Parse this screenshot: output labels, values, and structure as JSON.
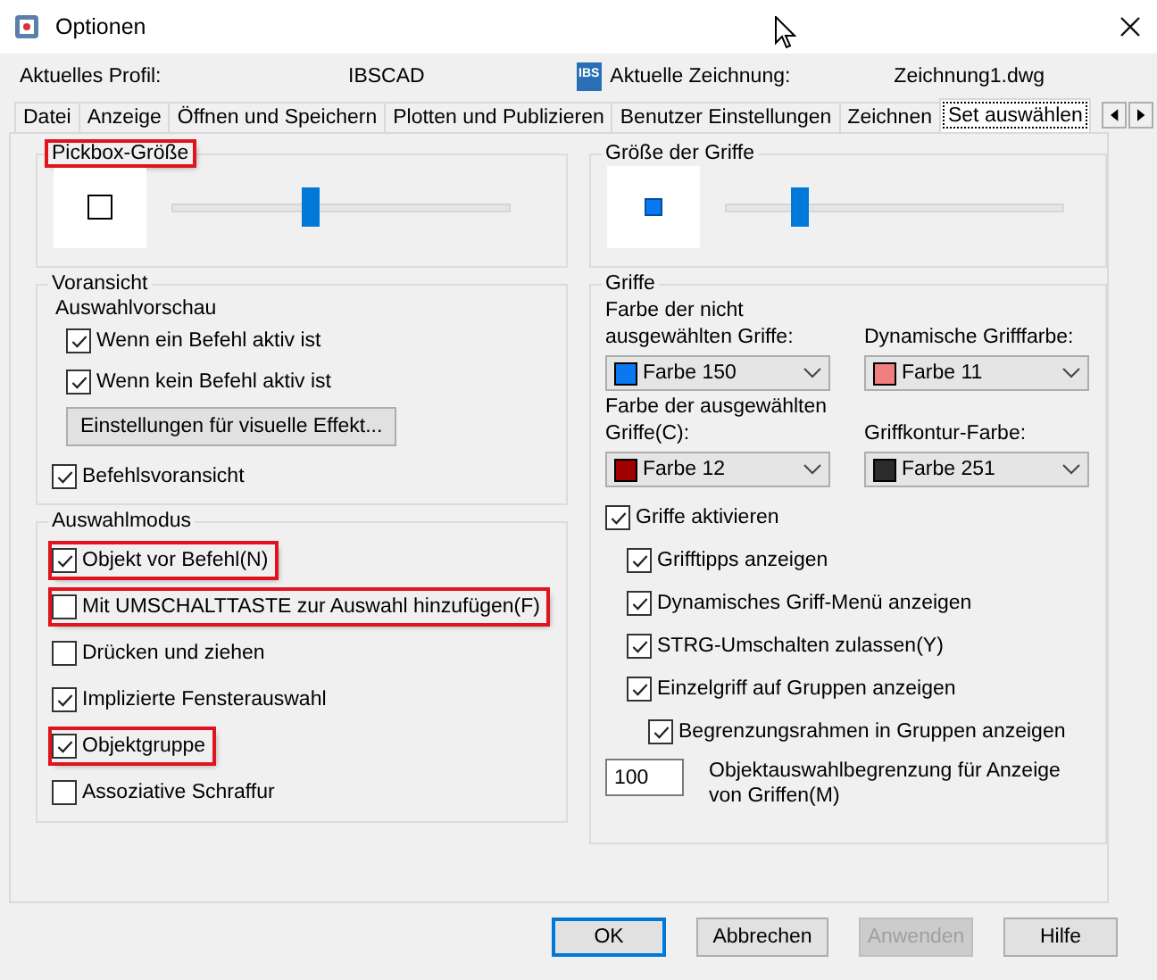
{
  "window": {
    "title": "Optionen"
  },
  "profile": {
    "label": "Aktuelles Profil:",
    "value": "IBSCAD"
  },
  "drawing": {
    "logo": "IBS",
    "label": "Aktuelle Zeichnung:",
    "value": "Zeichnung1.dwg"
  },
  "tabs": [
    {
      "label": "Datei",
      "selected": false
    },
    {
      "label": "Anzeige",
      "selected": false
    },
    {
      "label": "Öffnen und Speichern",
      "selected": false
    },
    {
      "label": "Plotten und Publizieren",
      "selected": false
    },
    {
      "label": "Benutzer Einstellungen",
      "selected": false
    },
    {
      "label": "Zeichnen",
      "selected": false
    },
    {
      "label": "Set auswählen",
      "selected": true
    }
  ],
  "pickbox": {
    "title": "Pickbox-Größe",
    "highlighted": true,
    "level": 0.41
  },
  "grip_size": {
    "title": "Größe der Griffe",
    "level": 0.22
  },
  "preview": {
    "title": "Voransicht",
    "subtitle": "Auswahlvorschau",
    "options": [
      {
        "label": "Wenn ein Befehl aktiv ist",
        "checked": true
      },
      {
        "label": "Wenn kein Befehl aktiv ist",
        "checked": true
      }
    ],
    "button": "Einstellungen für visuelle Effekt...",
    "command_preview": {
      "label": "Befehlsvoransicht",
      "checked": true
    }
  },
  "selection_mode": {
    "title": "Auswahlmodus",
    "options": [
      {
        "label": "Objekt vor Befehl(N)",
        "checked": true,
        "highlighted": true
      },
      {
        "label": "Mit UMSCHALTTASTE zur Auswahl hinzufügen(F)",
        "checked": false,
        "highlighted": true
      },
      {
        "label": "Drücken und ziehen",
        "checked": false,
        "highlighted": false
      },
      {
        "label": "Implizierte Fensterauswahl",
        "checked": true,
        "highlighted": false
      },
      {
        "label": "Objektgruppe",
        "checked": true,
        "highlighted": true
      },
      {
        "label": "Assoziative Schraffur",
        "checked": false,
        "highlighted": false
      }
    ]
  },
  "grips": {
    "title": "Griffe",
    "colors": [
      {
        "label": "Farbe der nicht ausgewählten Griffe:",
        "value": "Farbe 150",
        "color": "#0a78f0"
      },
      {
        "label": "Dynamische Grifffarbe:",
        "value": "Farbe 11",
        "color": "#f08080"
      },
      {
        "label": "Farbe der ausgewählten Griffe(C):",
        "value": "Farbe 12",
        "color": "#a00000"
      },
      {
        "label": "Griffkontur-Farbe:",
        "value": "Farbe 251",
        "color": "#2b2b2b"
      }
    ],
    "enable": {
      "label": "Griffe aktivieren",
      "checked": true,
      "children": [
        {
          "label": "Grifftipps anzeigen",
          "checked": true
        },
        {
          "label": "Dynamisches Griff-Menü anzeigen",
          "checked": true
        },
        {
          "label": "STRG-Umschalten zulassen(Y)",
          "checked": true
        },
        {
          "label": "Einzelgriff auf Gruppen anzeigen",
          "checked": true,
          "children": [
            {
              "label": "Begrenzungsrahmen in Gruppen anzeigen",
              "checked": true
            }
          ]
        }
      ]
    },
    "limit": {
      "value": "100",
      "label": "Objektauswahlbegrenzung für Anzeige von Griffen(M)"
    }
  },
  "buttons": [
    {
      "label": "OK",
      "kind": "default",
      "disabled": false
    },
    {
      "label": "Abbrechen",
      "kind": "normal",
      "disabled": false
    },
    {
      "label": "Anwenden",
      "kind": "normal",
      "disabled": true
    },
    {
      "label": "Hilfe",
      "kind": "normal",
      "disabled": false
    }
  ]
}
